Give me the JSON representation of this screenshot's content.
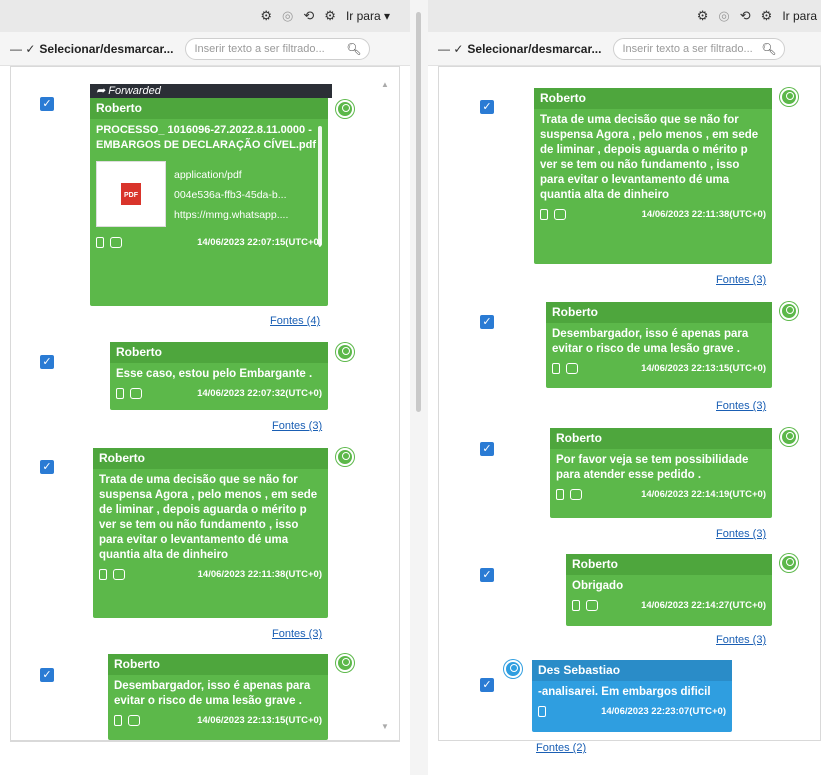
{
  "toolbar": {
    "goto_label": "Ir para",
    "select_label": "Selecionar/desmarcar...",
    "filter_placeholder": "Inserir texto a ser filtrado..."
  },
  "left_messages": [
    {
      "forwarded_label": "Forwarded",
      "sender": "Roberto",
      "attachment_title": "PROCESSO_ 1016096-27.2022.8.11.0000 - EMBARGOS DE DECLARAÇÃO CÍVEL.pdf",
      "attachment_type": "application/pdf",
      "attachment_id": "004e536a-ffb3-45da-b...",
      "attachment_url": "https://mmg.whatsapp....",
      "timestamp": "14/06/2023 22:07:15(UTC+0)",
      "fontes": "Fontes (4)"
    },
    {
      "sender": "Roberto",
      "text": "Esse caso, estou pelo Embargante .",
      "timestamp": "14/06/2023 22:07:32(UTC+0)",
      "fontes": "Fontes (3)"
    },
    {
      "sender": "Roberto",
      "text": "Trata de uma decisão que se não for suspensa  Agora , pelo menos , em sede de liminar , depois aguarda o mérito p ver se tem ou não fundamento , isso para evitar o levantamento dé uma quantia alta de dinheiro",
      "timestamp": "14/06/2023 22:11:38(UTC+0)",
      "fontes": "Fontes (3)"
    },
    {
      "sender": "Roberto",
      "text": "Desembargador, isso é apenas para evitar o risco de uma lesão grave .",
      "timestamp": "14/06/2023 22:13:15(UTC+0)"
    }
  ],
  "right_messages": [
    {
      "sender": "Roberto",
      "text": "Trata de uma decisão que se não for suspensa  Agora , pelo menos , em sede de liminar , depois aguarda o mérito p ver se tem ou não fundamento , isso para evitar o levantamento dé uma quantia alta de dinheiro",
      "timestamp": "14/06/2023 22:11:38(UTC+0)",
      "fontes": "Fontes (3)"
    },
    {
      "sender": "Roberto",
      "text": "Desembargador, isso é apenas para evitar o risco de uma lesão grave .",
      "timestamp": "14/06/2023 22:13:15(UTC+0)",
      "fontes": "Fontes (3)"
    },
    {
      "sender": "Roberto",
      "text": "Por favor veja se tem possibilidade para atender esse pedido .",
      "timestamp": "14/06/2023 22:14:19(UTC+0)",
      "fontes": "Fontes (3)"
    },
    {
      "sender": "Roberto",
      "text": "Obrigado",
      "timestamp": "14/06/2023 22:14:27(UTC+0)",
      "fontes": "Fontes (3)"
    },
    {
      "sender": "Des Sebastiao",
      "text": "-analisarei. Em embargos dificil",
      "timestamp": "14/06/2023 22:23:07(UTC+0)",
      "fontes": "Fontes (2)"
    }
  ],
  "colors": {
    "outgoing": "#5cb84a",
    "incoming": "#2f9ee0",
    "check": "#2a7bd4",
    "link": "#1a5fb4"
  }
}
